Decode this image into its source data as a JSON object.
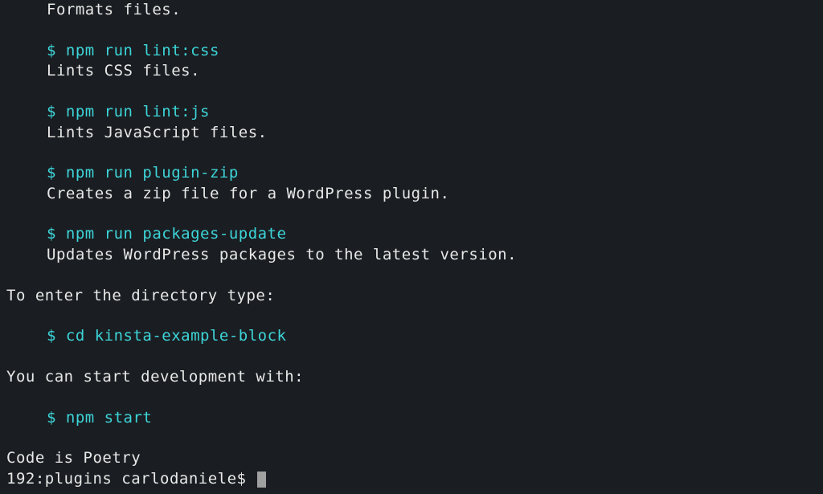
{
  "commands": [
    {
      "cmd": "",
      "desc": "Formats files."
    },
    {
      "cmd": "$ npm run lint:css",
      "desc": "Lints CSS files."
    },
    {
      "cmd": "$ npm run lint:js",
      "desc": "Lints JavaScript files."
    },
    {
      "cmd": "$ npm run plugin-zip",
      "desc": "Creates a zip file for a WordPress plugin."
    },
    {
      "cmd": "$ npm run packages-update",
      "desc": "Updates WordPress packages to the latest version."
    }
  ],
  "enter_dir_label": "To enter the directory type:",
  "enter_dir_cmd": "$ cd kinsta-example-block",
  "start_dev_label": "You can start development with:",
  "start_dev_cmd": "$ npm start",
  "tagline": "Code is Poetry",
  "prompt": "192:plugins carlodaniele$ "
}
